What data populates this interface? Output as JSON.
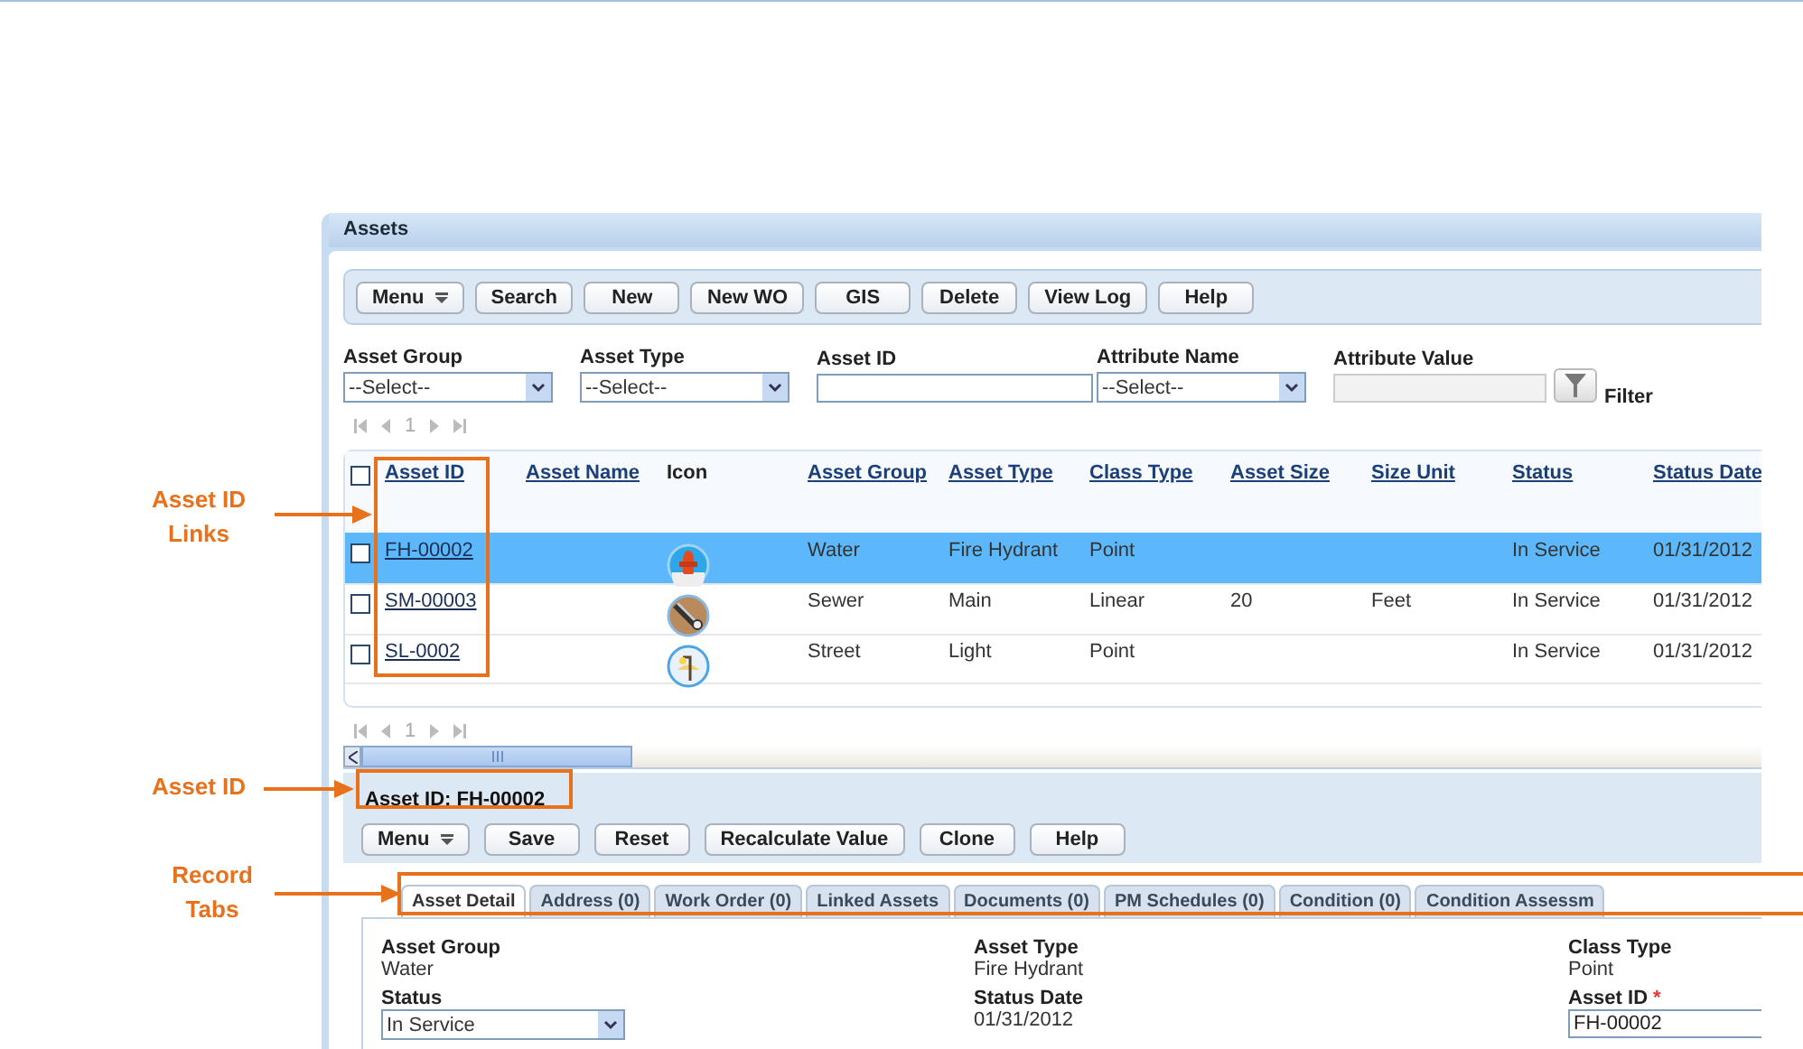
{
  "annotations": [
    {
      "label": "Asset ID Links",
      "kind": "column"
    },
    {
      "label": "Asset ID",
      "kind": "title"
    },
    {
      "label": "Record Tabs",
      "kind": "tabs"
    }
  ],
  "panel": {
    "title": "Assets"
  },
  "toolbar": [
    {
      "label": "Menu",
      "kind": "menu"
    },
    {
      "label": "Search",
      "kind": "button"
    },
    {
      "label": "New",
      "kind": "button"
    },
    {
      "label": "New WO",
      "kind": "button"
    },
    {
      "label": "GIS",
      "kind": "button"
    },
    {
      "label": "Delete",
      "kind": "button"
    },
    {
      "label": "View Log",
      "kind": "button"
    },
    {
      "label": "Help",
      "kind": "button"
    }
  ],
  "filters": [
    {
      "label": "Asset Group",
      "kind": "select",
      "value": "--Select--"
    },
    {
      "label": "Asset Type",
      "kind": "select",
      "value": "--Select--"
    },
    {
      "label": "Asset ID",
      "kind": "text"
    },
    {
      "label": "Attribute Name",
      "kind": "select",
      "value": "--Select--"
    },
    {
      "label": "Attribute Value",
      "kind": "disabled"
    }
  ],
  "filter_button": {
    "label": "Filter"
  },
  "top_pager": {
    "page": "1"
  },
  "table": {
    "header_checked": false,
    "columns": [
      "Asset ID",
      "Asset Name",
      "Icon",
      "Asset Group",
      "Asset Type",
      "Class Type",
      "Asset Size",
      "Size Unit",
      "Status",
      "Status Date"
    ],
    "rows": [
      {
        "selected": true,
        "checked": false,
        "asset_id": "FH-00002",
        "kind": "hydrant",
        "asset_group": "Water",
        "asset_type": "Fire Hydrant",
        "class_type": "Point",
        "status": "In Service",
        "status_date": "01/31/2012"
      },
      {
        "selected": false,
        "checked": false,
        "asset_id": "SM-00003",
        "kind": "pipe",
        "asset_group": "Sewer",
        "asset_type": "Main",
        "class_type": "Linear",
        "asset_size": "20",
        "size_unit": "Feet",
        "status": "In Service",
        "status_date": "01/31/2012"
      },
      {
        "selected": false,
        "checked": false,
        "asset_id": "SL-0002",
        "kind": "lamp",
        "asset_group": "Street",
        "asset_type": "Light",
        "class_type": "Point",
        "status": "In Service",
        "status_date": "01/31/2012"
      }
    ]
  },
  "bottom_pager": {
    "page": "1"
  },
  "record": {
    "title": "Asset ID: FH-00002",
    "toolbar": [
      {
        "label": "Menu",
        "kind": "menu"
      },
      {
        "label": "Save",
        "kind": "button"
      },
      {
        "label": "Reset",
        "kind": "button"
      },
      {
        "label": "Recalculate Value",
        "kind": "button"
      },
      {
        "label": "Clone",
        "kind": "button"
      },
      {
        "label": "Help",
        "kind": "button"
      }
    ],
    "tabs": [
      {
        "label": "Asset Detail",
        "selected": true
      },
      {
        "label": "Address (0)",
        "selected": false
      },
      {
        "label": "Work Order (0)",
        "selected": false
      },
      {
        "label": "Linked Assets",
        "selected": false
      },
      {
        "label": "Documents (0)",
        "selected": false
      },
      {
        "label": "PM Schedules (0)",
        "selected": false
      },
      {
        "label": "Condition (0)",
        "selected": false
      },
      {
        "label": "Condition Assessm",
        "selected": false
      }
    ],
    "field_columns": [
      [
        {
          "label": "Asset Group",
          "kind": "text",
          "value": "Water"
        },
        {
          "label": "Status",
          "kind": "select",
          "value": "In Service"
        }
      ],
      [
        {
          "label": "Asset Type",
          "kind": "text",
          "value": "Fire Hydrant"
        },
        {
          "label": "Status Date",
          "kind": "text",
          "value": "01/31/2012"
        }
      ],
      [
        {
          "label": "Class Type",
          "kind": "text",
          "value": "Point"
        },
        {
          "label": "Asset ID",
          "kind": "input",
          "required_mark": "*",
          "value": "FH-00002"
        }
      ]
    ]
  }
}
